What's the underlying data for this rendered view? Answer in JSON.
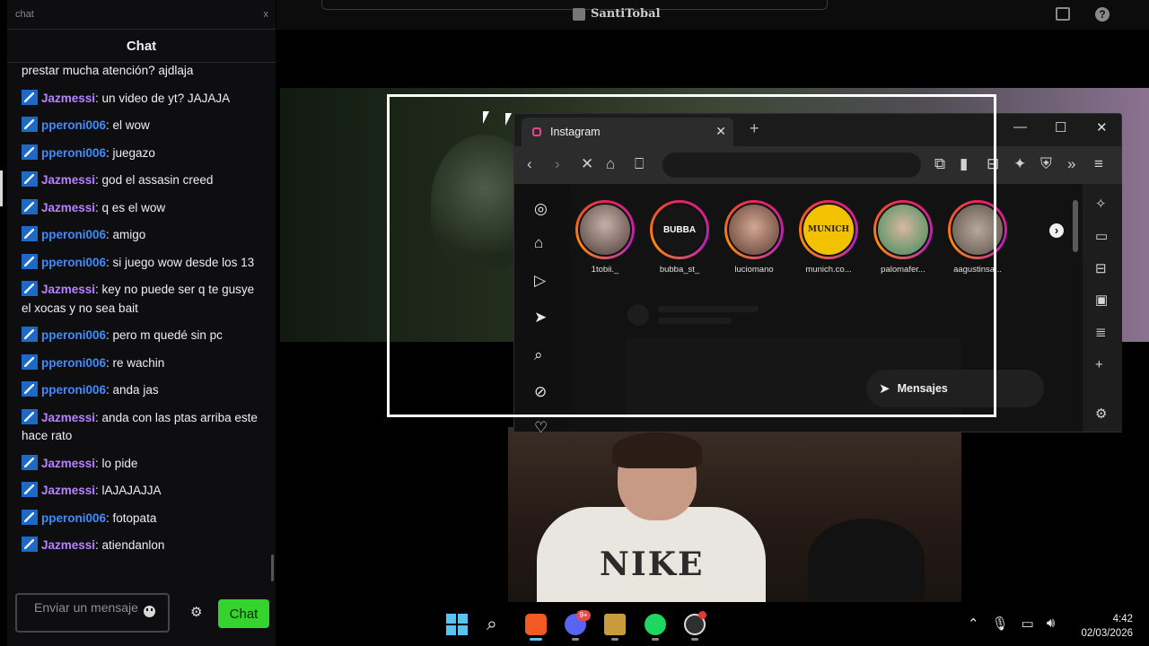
{
  "chat": {
    "window_title": "chat",
    "close_label": "x",
    "header": "Chat",
    "messages": [
      {
        "user": "",
        "text": "prestar mucha atención? ajdlaja",
        "color": "plain"
      },
      {
        "user": "Jazmessi",
        "text": ": un video de yt? JAJAJA",
        "color": "purple"
      },
      {
        "user": "pperoni006",
        "text": ": el wow",
        "color": "blue"
      },
      {
        "user": "pperoni006",
        "text": ": juegazo",
        "color": "blue"
      },
      {
        "user": "Jazmessi",
        "text": ": god el assasin creed",
        "color": "purple"
      },
      {
        "user": "Jazmessi",
        "text": ": q es el wow",
        "color": "purple"
      },
      {
        "user": "pperoni006",
        "text": ": amigo",
        "color": "blue"
      },
      {
        "user": "pperoni006",
        "text": ": si juego wow desde los 13",
        "color": "blue"
      },
      {
        "user": "Jazmessi",
        "text": ": key no puede ser q te gusye el xocas y no sea bait",
        "color": "purple"
      },
      {
        "user": "pperoni006",
        "text": ": pero m quedé sin pc",
        "color": "blue"
      },
      {
        "user": "pperoni006",
        "text": ": re wachin",
        "color": "blue"
      },
      {
        "user": "pperoni006",
        "text": ": anda jas",
        "color": "blue"
      },
      {
        "user": "Jazmessi",
        "text": ": anda con las ptas arriba este hace rato",
        "color": "purple"
      },
      {
        "user": "Jazmessi",
        "text": ": lo pide",
        "color": "purple"
      },
      {
        "user": "Jazmessi",
        "text": ": lAJAJAJJA",
        "color": "purple"
      },
      {
        "user": "pperoni006",
        "text": ": fotopata",
        "color": "blue"
      },
      {
        "user": "Jazmessi",
        "text": ": atiendanlon",
        "color": "purple"
      }
    ],
    "input_placeholder": "Enviar un mensaje",
    "send_label": "Chat",
    "colors": {
      "purple": "#b781ff",
      "blue": "#3f8cff",
      "send": "#34d32e"
    }
  },
  "stream": {
    "streamer_name": "SantiTobal",
    "shirt_text": "NIKE"
  },
  "browser": {
    "tab_title": "Instagram",
    "tab_close": "✕",
    "new_tab": "+",
    "window_controls": {
      "minimize": "—",
      "maximize": "☐",
      "close": "✕"
    },
    "stories": [
      "1tobii._",
      "bubba_st_",
      "luciomano",
      "munich.co...",
      "palomafer...",
      "aagustinsa..."
    ],
    "story_labels": {
      "bubba": "BUBBA",
      "munich": "MUNICH"
    },
    "messages_button": "Mensajes"
  },
  "taskbar": {
    "discord_badge": "9+",
    "clock_time": "4:42",
    "clock_date": "02/03/2026"
  },
  "icons": {
    "chat_settings": "gear-icon",
    "emote": "smiley-icon",
    "help": "question-icon"
  }
}
